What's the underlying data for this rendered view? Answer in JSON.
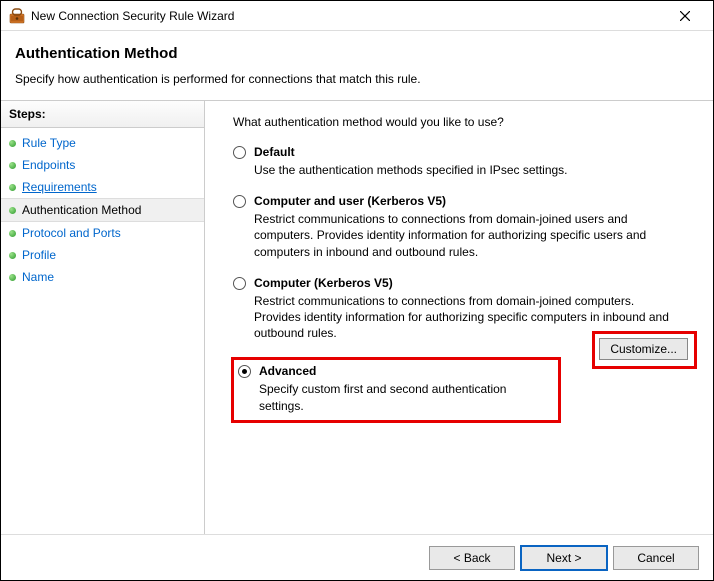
{
  "window": {
    "title": "New Connection Security Rule Wizard"
  },
  "header": {
    "title": "Authentication Method",
    "subtitle": "Specify how authentication is performed for connections that match this rule."
  },
  "steps": {
    "label": "Steps:",
    "items": [
      {
        "label": "Rule Type"
      },
      {
        "label": "Endpoints"
      },
      {
        "label": "Requirements"
      },
      {
        "label": "Authentication Method"
      },
      {
        "label": "Protocol and Ports"
      },
      {
        "label": "Profile"
      },
      {
        "label": "Name"
      }
    ]
  },
  "content": {
    "prompt": "What authentication method would you like to use?",
    "options": {
      "default": {
        "label": "Default",
        "desc": "Use the authentication methods specified in IPsec settings."
      },
      "comp_user": {
        "label": "Computer and user (Kerberos V5)",
        "desc": "Restrict communications to connections from domain-joined users and computers. Provides identity information for authorizing specific users and computers in inbound and outbound rules."
      },
      "comp": {
        "label": "Computer (Kerberos V5)",
        "desc": "Restrict communications to connections from domain-joined computers.  Provides identity information for authorizing specific computers in inbound and outbound rules."
      },
      "advanced": {
        "label": "Advanced",
        "desc": "Specify custom first and second authentication settings."
      }
    },
    "customize": "Customize..."
  },
  "footer": {
    "back": "< Back",
    "next": "Next >",
    "cancel": "Cancel"
  }
}
